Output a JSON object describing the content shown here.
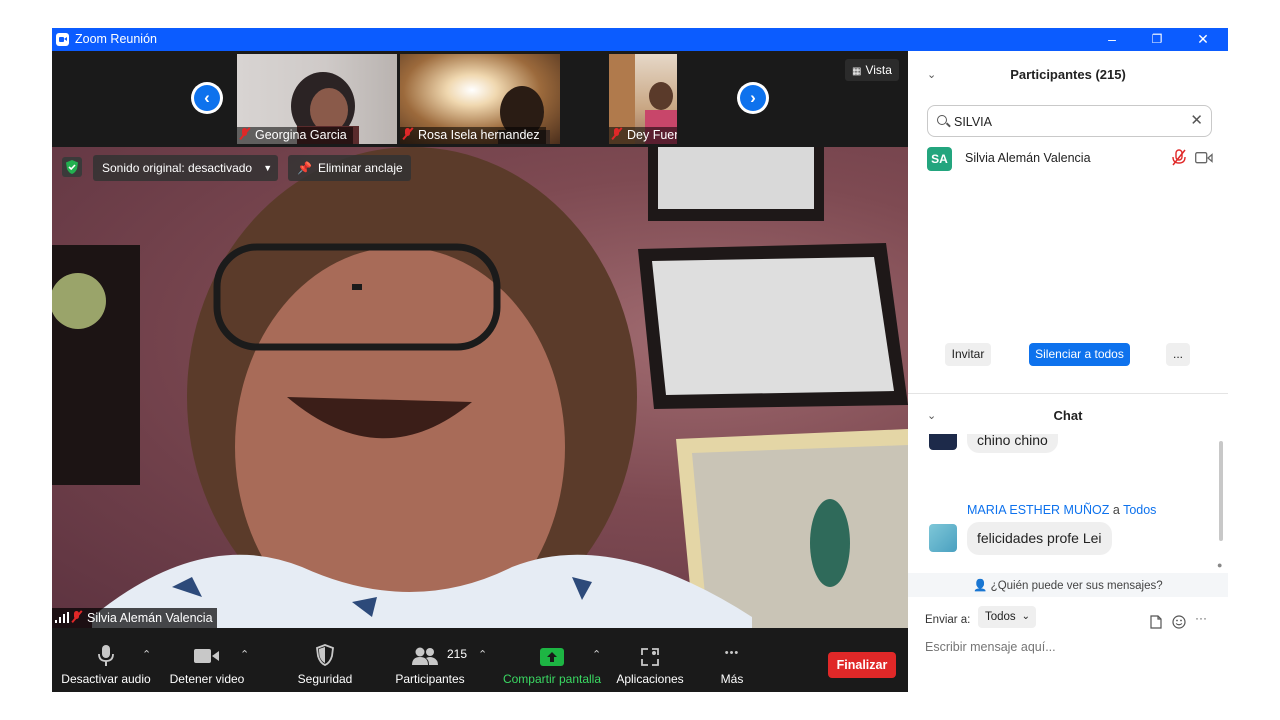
{
  "window": {
    "title": "Zoom Reunión",
    "minimize": "–",
    "restore": "❐",
    "close": "✕"
  },
  "strip": {
    "participants": [
      {
        "name": "Georgina Garcia"
      },
      {
        "name": "Rosa Isela hernandez"
      },
      {
        "name": "Dey Fuentes"
      }
    ],
    "prev_icon": "‹",
    "next_icon": "›",
    "view_label": "Vista"
  },
  "main_video": {
    "sound_label": "Sonido original: desactivado",
    "unpin_label": "Eliminar anclaje",
    "speaker_name": "Silvia Alemán Valencia"
  },
  "toolbar": {
    "mute": "Desactivar audio",
    "video": "Detener video",
    "security": "Seguridad",
    "participants": "Participantes",
    "participants_count": "215",
    "share": "Compartir pantalla",
    "apps": "Aplicaciones",
    "more": "Más",
    "end": "Finalizar",
    "more_dots": "•••"
  },
  "participants_panel": {
    "title": "Participantes (215)",
    "search_value": "SILVIA",
    "results": [
      {
        "initials": "SA",
        "name": "Silvia Alemán Valencia"
      }
    ],
    "invite": "Invitar",
    "mute_all": "Silenciar a todos",
    "more": "..."
  },
  "chat": {
    "title": "Chat",
    "messages": [
      {
        "text": "chino chino"
      },
      {
        "sender": "MARIA ESTHER MUÑOZ",
        "connector": "a",
        "recipient": "Todos",
        "text": "felicidades profe Lei"
      }
    ],
    "visibility_note": "¿Quién puede ver sus mensajes?",
    "send_to_label": "Enviar a:",
    "send_to_value": "Todos",
    "placeholder": "Escribir mensaje aquí...",
    "more": "···"
  },
  "colors": {
    "titlebar": "#0b5cff",
    "accent": "#0e72ed",
    "end_button": "#e02828",
    "share_green": "#1db543",
    "link_blue": "#0e72ed"
  },
  "icons": [
    "zoom-logo-icon",
    "chevron-left-icon",
    "chevron-right-icon",
    "grid-icon",
    "shield-icon",
    "pin-icon",
    "microphone-icon",
    "camera-icon",
    "security-shield-icon",
    "participants-icon",
    "share-screen-icon",
    "apps-icon",
    "more-icon",
    "search-icon",
    "clear-icon",
    "mic-muted-icon",
    "video-off-icon",
    "file-icon",
    "emoji-icon",
    "signal-icon"
  ]
}
